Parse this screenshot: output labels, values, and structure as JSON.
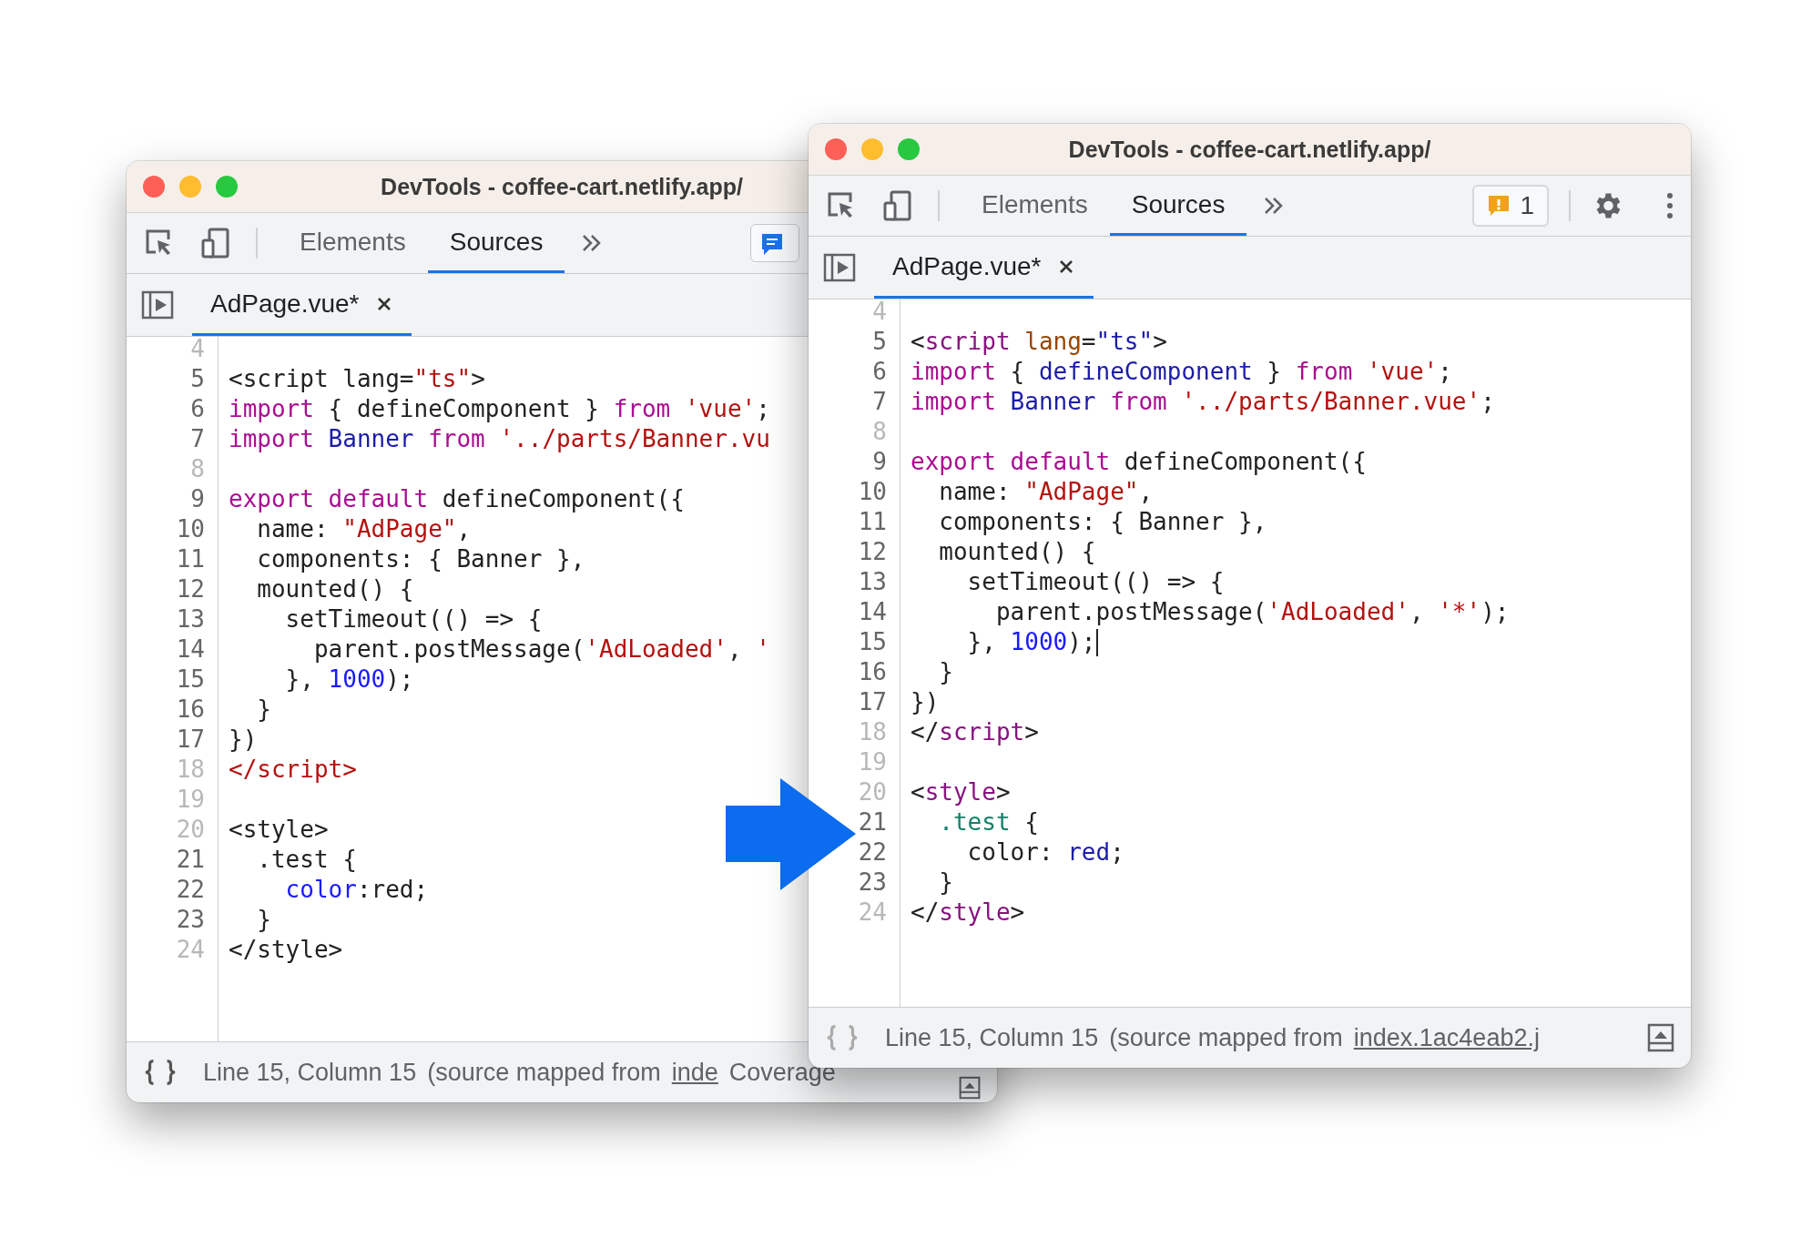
{
  "windows": [
    {
      "title": "DevTools - coffee-cart.netlify.app/",
      "tabs": [
        {
          "label": "Elements",
          "selected": false
        },
        {
          "label": "Sources",
          "selected": true
        }
      ],
      "messages_button": true,
      "file_tab": {
        "label": "AdPage.vue*",
        "selected": true
      },
      "code_lines": [
        {
          "number": "4",
          "dim": true
        },
        {
          "number": "5",
          "dim": false,
          "tokens": [
            {
              "kind": "plain",
              "text": "<script lang="
            },
            {
              "kind": "string",
              "text": "\"ts\""
            },
            {
              "kind": "plain",
              "text": ">"
            }
          ]
        },
        {
          "number": "6",
          "dim": false,
          "tokens": [
            {
              "kind": "keyword",
              "text": "import"
            },
            {
              "kind": "plain",
              "text": " { defineComponent } "
            },
            {
              "kind": "keyword",
              "text": "from"
            },
            {
              "kind": "string",
              "text": " 'vue'"
            },
            {
              "kind": "plain",
              "text": ";"
            }
          ]
        },
        {
          "number": "7",
          "dim": false,
          "tokens": [
            {
              "kind": "keyword",
              "text": "import"
            },
            {
              "kind": "def",
              "text": " Banner"
            },
            {
              "kind": "keyword",
              "text": " from"
            },
            {
              "kind": "string",
              "text": " '../parts/Banner.vu"
            }
          ]
        },
        {
          "number": "8",
          "dim": true
        },
        {
          "number": "9",
          "dim": false,
          "tokens": [
            {
              "kind": "keyword",
              "text": "export default"
            },
            {
              "kind": "plain",
              "text": " defineComponent({"
            }
          ]
        },
        {
          "number": "10",
          "dim": false,
          "tokens": [
            {
              "kind": "plain",
              "text": "  name: "
            },
            {
              "kind": "string",
              "text": "\"AdPage\""
            },
            {
              "kind": "plain",
              "text": ","
            }
          ]
        },
        {
          "number": "11",
          "dim": false,
          "tokens": [
            {
              "kind": "plain",
              "text": "  components: { Banner },"
            }
          ]
        },
        {
          "number": "12",
          "dim": false,
          "tokens": [
            {
              "kind": "plain",
              "text": "  mounted() {"
            }
          ]
        },
        {
          "number": "13",
          "dim": false,
          "tokens": [
            {
              "kind": "plain",
              "text": "    setTimeout(() => {"
            }
          ]
        },
        {
          "number": "14",
          "dim": false,
          "tokens": [
            {
              "kind": "plain",
              "text": "      parent.postMessage("
            },
            {
              "kind": "string",
              "text": "'AdLoaded'"
            },
            {
              "kind": "plain",
              "text": ", "
            },
            {
              "kind": "string",
              "text": "'"
            }
          ]
        },
        {
          "number": "15",
          "dim": false,
          "tokens": [
            {
              "kind": "plain",
              "text": "    }, "
            },
            {
              "kind": "number",
              "text": "1000"
            },
            {
              "kind": "plain",
              "text": ");"
            }
          ]
        },
        {
          "number": "16",
          "dim": false,
          "tokens": [
            {
              "kind": "plain",
              "text": "  }"
            }
          ]
        },
        {
          "number": "17",
          "dim": false,
          "tokens": [
            {
              "kind": "plain",
              "text": "})"
            }
          ]
        },
        {
          "number": "18",
          "dim": true,
          "tokens": [
            {
              "kind": "string",
              "text": "</script>"
            }
          ]
        },
        {
          "number": "19",
          "dim": true
        },
        {
          "number": "20",
          "dim": true,
          "tokens": [
            {
              "kind": "plain",
              "text": "<style>"
            }
          ]
        },
        {
          "number": "21",
          "dim": false,
          "tokens": [
            {
              "kind": "plain",
              "text": "  .test {"
            }
          ]
        },
        {
          "number": "22",
          "dim": false,
          "tokens": [
            {
              "kind": "number",
              "text": "    color"
            },
            {
              "kind": "plain",
              "text": ":red;"
            }
          ]
        },
        {
          "number": "23",
          "dim": false,
          "tokens": [
            {
              "kind": "plain",
              "text": "  }"
            }
          ]
        },
        {
          "number": "24",
          "dim": true,
          "tokens": [
            {
              "kind": "plain",
              "text": "</style>"
            }
          ]
        }
      ],
      "status": {
        "position": "Line 15, Column 15",
        "mapped": "(source mapped from",
        "link": "inde",
        "extra": "Coverage"
      }
    },
    {
      "title": "DevTools - coffee-cart.netlify.app/",
      "tabs": [
        {
          "label": "Elements",
          "selected": false
        },
        {
          "label": "Sources",
          "selected": true
        }
      ],
      "issues_badge": "1",
      "file_tab": {
        "label": "AdPage.vue*",
        "selected": true
      },
      "code_lines": [
        {
          "number": "4",
          "dim": true
        },
        {
          "number": "5",
          "dim": false,
          "tokens": [
            {
              "kind": "plain",
              "text": "<"
            },
            {
              "kind": "tag",
              "text": "script"
            },
            {
              "kind": "attr",
              "text": " lang"
            },
            {
              "kind": "plain",
              "text": "="
            },
            {
              "kind": "def",
              "text": "\"ts\""
            },
            {
              "kind": "plain",
              "text": ">"
            }
          ]
        },
        {
          "number": "6",
          "dim": false,
          "tokens": [
            {
              "kind": "keyword",
              "text": "import"
            },
            {
              "kind": "plain",
              "text": " { "
            },
            {
              "kind": "def",
              "text": "defineComponent"
            },
            {
              "kind": "plain",
              "text": " } "
            },
            {
              "kind": "keyword",
              "text": "from"
            },
            {
              "kind": "string",
              "text": " 'vue'"
            },
            {
              "kind": "plain",
              "text": ";"
            }
          ]
        },
        {
          "number": "7",
          "dim": false,
          "tokens": [
            {
              "kind": "keyword",
              "text": "import"
            },
            {
              "kind": "def",
              "text": " Banner"
            },
            {
              "kind": "keyword",
              "text": " from"
            },
            {
              "kind": "string",
              "text": " '../parts/Banner.vue'"
            },
            {
              "kind": "plain",
              "text": ";"
            }
          ]
        },
        {
          "number": "8",
          "dim": true
        },
        {
          "number": "9",
          "dim": false,
          "tokens": [
            {
              "kind": "keyword",
              "text": "export default"
            },
            {
              "kind": "plain",
              "text": " defineComponent({"
            }
          ]
        },
        {
          "number": "10",
          "dim": false,
          "tokens": [
            {
              "kind": "plain",
              "text": "  name: "
            },
            {
              "kind": "string",
              "text": "\"AdPage\""
            },
            {
              "kind": "plain",
              "text": ","
            }
          ]
        },
        {
          "number": "11",
          "dim": false,
          "tokens": [
            {
              "kind": "plain",
              "text": "  components: { Banner },"
            }
          ]
        },
        {
          "number": "12",
          "dim": false,
          "tokens": [
            {
              "kind": "plain",
              "text": "  mounted() {"
            }
          ]
        },
        {
          "number": "13",
          "dim": false,
          "tokens": [
            {
              "kind": "plain",
              "text": "    setTimeout(() => {"
            }
          ]
        },
        {
          "number": "14",
          "dim": false,
          "tokens": [
            {
              "kind": "plain",
              "text": "      parent.postMessage("
            },
            {
              "kind": "string",
              "text": "'AdLoaded'"
            },
            {
              "kind": "plain",
              "text": ", "
            },
            {
              "kind": "string",
              "text": "'*'"
            },
            {
              "kind": "plain",
              "text": ");"
            }
          ]
        },
        {
          "number": "15",
          "dim": false,
          "cursor": true,
          "tokens": [
            {
              "kind": "plain",
              "text": "    }, "
            },
            {
              "kind": "number",
              "text": "1000"
            },
            {
              "kind": "plain",
              "text": ");"
            }
          ]
        },
        {
          "number": "16",
          "dim": false,
          "tokens": [
            {
              "kind": "plain",
              "text": "  }"
            }
          ]
        },
        {
          "number": "17",
          "dim": false,
          "tokens": [
            {
              "kind": "plain",
              "text": "})"
            }
          ]
        },
        {
          "number": "18",
          "dim": true,
          "tokens": [
            {
              "kind": "plain",
              "text": "</"
            },
            {
              "kind": "tag",
              "text": "script"
            },
            {
              "kind": "plain",
              "text": ">"
            }
          ]
        },
        {
          "number": "19",
          "dim": true
        },
        {
          "number": "20",
          "dim": true,
          "tokens": [
            {
              "kind": "plain",
              "text": "<"
            },
            {
              "kind": "tag",
              "text": "style"
            },
            {
              "kind": "plain",
              "text": ">"
            }
          ]
        },
        {
          "number": "21",
          "dim": false,
          "tokens": [
            {
              "kind": "selector",
              "text": "  .test"
            },
            {
              "kind": "plain",
              "text": " {"
            }
          ]
        },
        {
          "number": "22",
          "dim": false,
          "tokens": [
            {
              "kind": "plain",
              "text": "    color: "
            },
            {
              "kind": "def",
              "text": "red"
            },
            {
              "kind": "plain",
              "text": ";"
            }
          ]
        },
        {
          "number": "23",
          "dim": false,
          "tokens": [
            {
              "kind": "plain",
              "text": "  }"
            }
          ]
        },
        {
          "number": "24",
          "dim": true,
          "tokens": [
            {
              "kind": "plain",
              "text": "</"
            },
            {
              "kind": "tag",
              "text": "style"
            },
            {
              "kind": "plain",
              "text": ">"
            }
          ]
        }
      ],
      "status": {
        "position": "Line 15, Column 15",
        "mapped": "(source mapped from",
        "link": "index.1ac4eab2.j"
      }
    }
  ]
}
